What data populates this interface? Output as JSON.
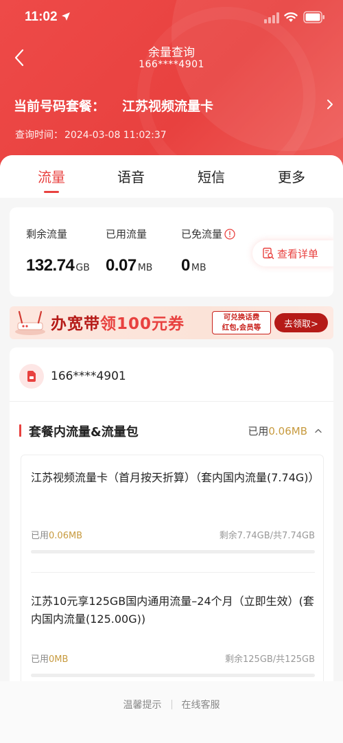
{
  "status_bar": {
    "time": "11:02"
  },
  "nav": {
    "title": "余量查询",
    "subtitle": "166****4901"
  },
  "plan": {
    "label": "当前号码套餐：",
    "name": "江苏视频流量卡"
  },
  "query_time": {
    "label": "查询时间：",
    "value": "2024-03-08 11:02:37"
  },
  "tabs": [
    {
      "label": "流量",
      "active": true
    },
    {
      "label": "语音",
      "active": false
    },
    {
      "label": "短信",
      "active": false
    },
    {
      "label": "更多",
      "active": false
    }
  ],
  "usage": {
    "remaining": {
      "label": "剩余流量",
      "value": "132.74",
      "unit": "GB"
    },
    "used": {
      "label": "已用流量",
      "value": "0.07",
      "unit": "MB"
    },
    "free": {
      "label": "已免流量",
      "value": "0",
      "unit": "MB"
    },
    "detail_button": "查看详单"
  },
  "banner": {
    "text_a": "办宽带",
    "text_b": "领100元券",
    "tag_line1": "可兑换话费",
    "tag_line2": "红包,会员等",
    "button": "去领取>"
  },
  "phone": "166****4901",
  "section": {
    "title": "套餐内流量&流量包",
    "used_label": "已用",
    "used_value": "0.06MB"
  },
  "packages": [
    {
      "name": "江苏视频流量卡（首月按天折算）（套内国内流量(7.74G)）",
      "used_label": "已用",
      "used_value": "0.06MB",
      "remain": "剩余7.74GB/共7.74GB",
      "used_fraction": 0.0
    },
    {
      "name": "江苏10元享125GB国内通用流量–24个月（立即生效）(套内国内流量(125.00G))",
      "used_label": "已用",
      "used_value": "0MB",
      "remain": "剩余125GB/共125GB",
      "used_fraction": 0.0
    }
  ],
  "footer": {
    "tips": "温馨提示",
    "service": "在线客服"
  },
  "colors": {
    "brand_red": "#e8413f",
    "gold": "#c79a3e"
  }
}
